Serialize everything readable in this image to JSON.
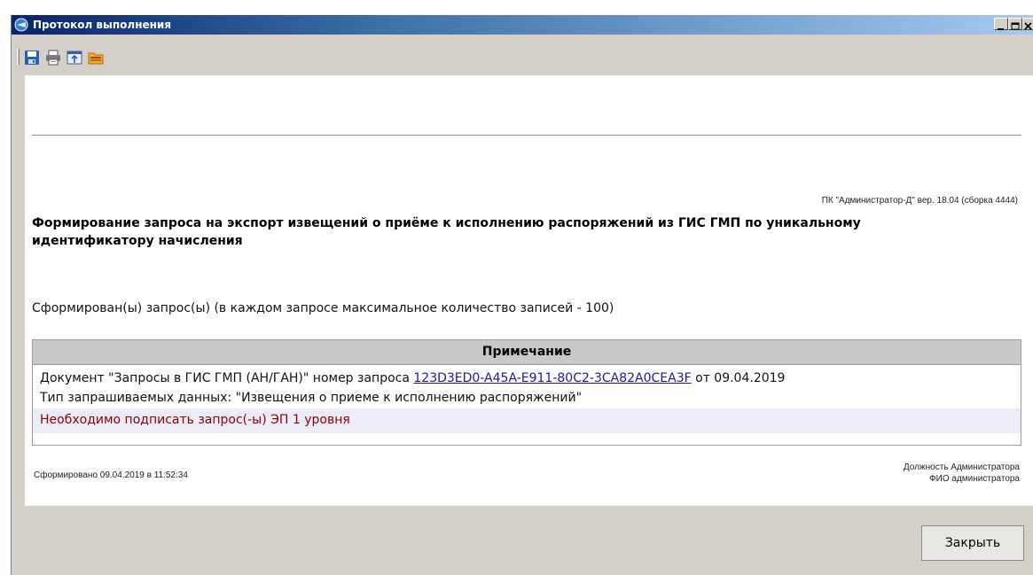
{
  "window": {
    "title": "Протокол выполнения",
    "minimize_icon": "minimize-icon",
    "maximize_icon": "maximize-icon",
    "close_icon": "close-icon"
  },
  "toolbar": {
    "tools": [
      {
        "icon": "save-icon"
      },
      {
        "icon": "print-icon"
      },
      {
        "icon": "export-icon"
      },
      {
        "icon": "open-folder-icon"
      }
    ]
  },
  "report": {
    "version": "ПК \"Администратор-Д\" вер. 18.04 (сборка 4444)",
    "heading": "Формирование запроса на экспорт извещений о приёме к исполнению распоряжений из ГИС ГМП по уникальному идентификатору начисления",
    "summary": "Сформирован(ы) запрос(ы) (в каждом запросе максимальное количество записей - 100)",
    "table": {
      "header": "Примечание",
      "doc_prefix": "Документ \"Запросы в ГИС ГМП (АН/ГАН)\" номер запроса ",
      "doc_link": "123D3ED0-A45A-E911-80C2-3CA82A0CEA3F",
      "doc_suffix": " от 09.04.2019",
      "data_type": "Тип запрашиваемых данных: \"Извещения о приеме к исполнению распоряжений\"",
      "warning": "Необходимо подписать запрос(-ы) ЭП 1 уровня"
    },
    "generated": "Сформировано 09.04.2019 в 11:52:34",
    "signatory_position": "Должность Администратора",
    "signatory_name": "ФИО администратора"
  },
  "buttons": {
    "close_label": "Закрыть"
  },
  "colors": {
    "title_gradient_start": "#0a246a",
    "title_gradient_end": "#a6caf0",
    "link": "#1a1aa6",
    "warning_text": "#8b0000",
    "warning_bg": "#ececf8"
  }
}
